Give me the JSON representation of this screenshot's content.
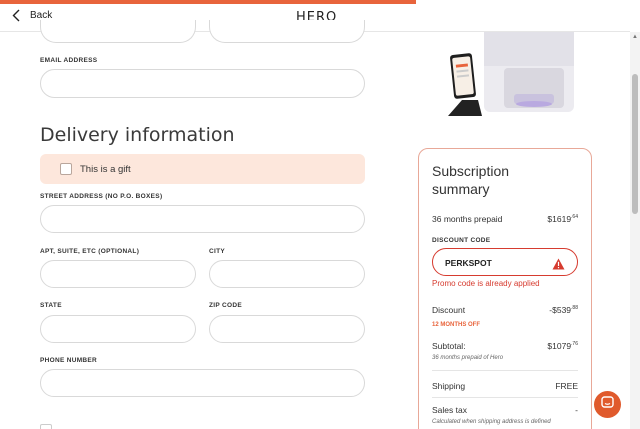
{
  "header": {
    "back_label": "Back",
    "logo_text": "HERO"
  },
  "form": {
    "email_label": "EMAIL ADDRESS",
    "delivery_heading": "Delivery information",
    "gift_label": "This is a gift",
    "street_label": "STREET ADDRESS (NO P.O. BOXES)",
    "apt_label": "APT, SUITE, ETC (OPTIONAL)",
    "city_label": "CITY",
    "state_label": "STATE",
    "zip_label": "ZIP CODE",
    "phone_label": "PHONE NUMBER"
  },
  "summary": {
    "title": "Subscription summary",
    "plan_label": "36 months prepaid",
    "plan_price_main": "$1619",
    "plan_price_cents": ".64",
    "discount_code_label": "DISCOUNT CODE",
    "promo_code": "PERKSPOT",
    "promo_error": "Promo code is already applied",
    "discount_label": "Discount",
    "discount_main": "-$539",
    "discount_cents": ".88",
    "discount_tag": "12 MONTHS OFF",
    "subtotal_label": "Subtotal:",
    "subtotal_main": "$1079",
    "subtotal_cents": ".76",
    "subtotal_note": "36 months prepaid of Hero",
    "shipping_label": "Shipping",
    "shipping_value": "FREE",
    "tax_label": "Sales tax",
    "tax_value": "-",
    "tax_note": "Calculated when shipping address is defined"
  },
  "colors": {
    "accent": "#e8643c",
    "error": "#d63b2f",
    "gift_bg": "#fde7dc"
  },
  "icons": {
    "back": "chevron-left-icon",
    "warning": "warning-icon",
    "chat": "chat-icon"
  }
}
